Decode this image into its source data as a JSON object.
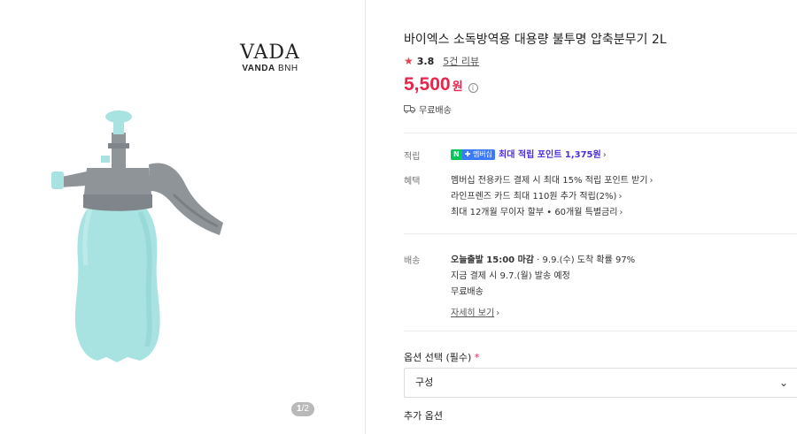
{
  "brand": {
    "logo_text": "VADA",
    "sub_bold": "VANDA",
    "sub_light": "BNH"
  },
  "gallery": {
    "pager_current": "1",
    "pager_total": "/2"
  },
  "product": {
    "title": "바이엑스 소독방역용 대용량 불투명 압축분무기 2L",
    "rating": "3.8",
    "reviews": "5건 리뷰",
    "price": "5,500",
    "currency": "원",
    "shipping_summary": "무료배송"
  },
  "points": {
    "label": "적립",
    "badge_n": "N",
    "badge_plus": "✚ 멤버십",
    "text": "최대 적립 포인트 1,375원"
  },
  "benefits": {
    "label": "혜택",
    "items": [
      "멤버십 전용카드 결제 시 최대 15% 적립 포인트 받기",
      "라인프렌즈 카드 최대 110원 추가 적립(2%)",
      "최대 12개월 무이자 할부 • 60개월 특별금리"
    ]
  },
  "delivery": {
    "label": "배송",
    "line1_bold": "오늘출발 15:00 마감",
    "line1_rest": " · 9.9.(수) 도착 확률 97%",
    "line2": "지금 결제 시 9.7.(월) 발송 예정",
    "line3": "무료배송",
    "details_link": "자세히 보기"
  },
  "options": {
    "label": "옵션 선택 (필수)",
    "required_mark": "*",
    "select_value": "구성",
    "additional_label": "추가 옵션"
  },
  "colors": {
    "accent_red": "#e8254b",
    "star_red": "#e8404f",
    "naver_green": "#03c75a",
    "point_purple": "#4a2ee0",
    "bottle_mint": "#a8e3e2",
    "cap_gray": "#8e9498"
  }
}
